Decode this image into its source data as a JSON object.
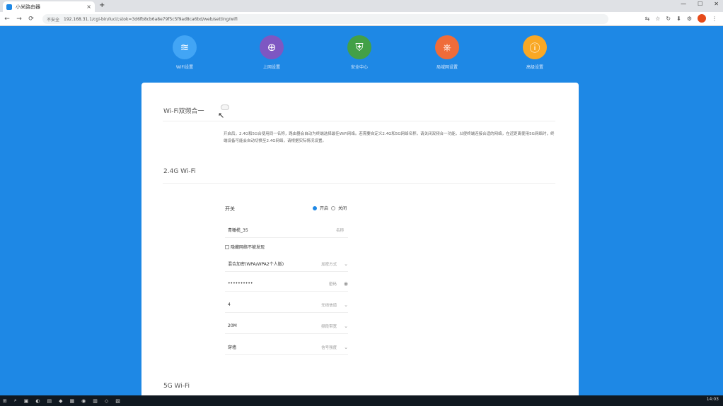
{
  "browser": {
    "tab_title": "小米路由器",
    "tab_close": "×",
    "new_tab": "+",
    "window_controls": [
      "—",
      "☐",
      "✕"
    ],
    "nav_buttons": [
      "←",
      "→",
      "⟳"
    ],
    "security_label": "不安全",
    "url": "192.168.31.1/cgi-bin/luci/;stok=3d6fb8cb6a8e79f5c5f9ad8ca6bd/web/setting/wifi",
    "toolbar_icons": [
      "⇆",
      "☆",
      "↻",
      "⬇",
      "⚙",
      "⋮"
    ]
  },
  "top_nav": {
    "items": [
      {
        "label": "WiFi设置",
        "icon": "wifi-icon",
        "glyph": "≋",
        "color": "#42a5f5"
      },
      {
        "label": "上网设置",
        "icon": "globe-icon",
        "glyph": "⊕",
        "color": "#7e57c2"
      },
      {
        "label": "安全中心",
        "icon": "shield-icon",
        "glyph": "⛨",
        "color": "#43a047"
      },
      {
        "label": "局域网设置",
        "icon": "network-icon",
        "glyph": "⎈",
        "color": "#ef6c3a"
      },
      {
        "label": "高级设置",
        "icon": "info-icon",
        "glyph": "ⓘ",
        "color": "#f9a825"
      }
    ]
  },
  "panel": {
    "section1_title": "Wi-Fi双频合一",
    "description": "开启后，2.4G和5G合使用同一名称，路由器会自动为终端选择最佳WiFi网络。若需要自定义2.4G和5G网络名称，请关闭双频合一功能，以便终端连接合适的网络，在近距离使用5G网络时，终端设备可能会自动切换至2.4G网络，请根据实际情况设置。",
    "section2_title": "2.4G Wi-Fi",
    "switch_label": "开关",
    "radio_on": "开启",
    "radio_off": "关闭",
    "ssid_value": "青橄榄_35",
    "ssid_hint": "名称",
    "hide_ssid_label": "隐藏网络不被发现",
    "encryption_value": "混合加密(WPA/WPA2个人版)",
    "encryption_hint": "加密方式",
    "password_value": "••••••••••",
    "password_hint": "密码",
    "channel_value": "4",
    "channel_hint": "无线信道",
    "bandwidth_value": "20M",
    "bandwidth_hint": "频段带宽",
    "signal_value": "穿墙",
    "signal_hint": "信号强度",
    "section3_title": "5G Wi-Fi"
  },
  "taskbar": {
    "icons": [
      "⊞",
      "⌕",
      "▣",
      "◐",
      "▤",
      "◆",
      "▦",
      "◉",
      "▥",
      "◇",
      "▧"
    ],
    "tray_time": "14:03"
  }
}
